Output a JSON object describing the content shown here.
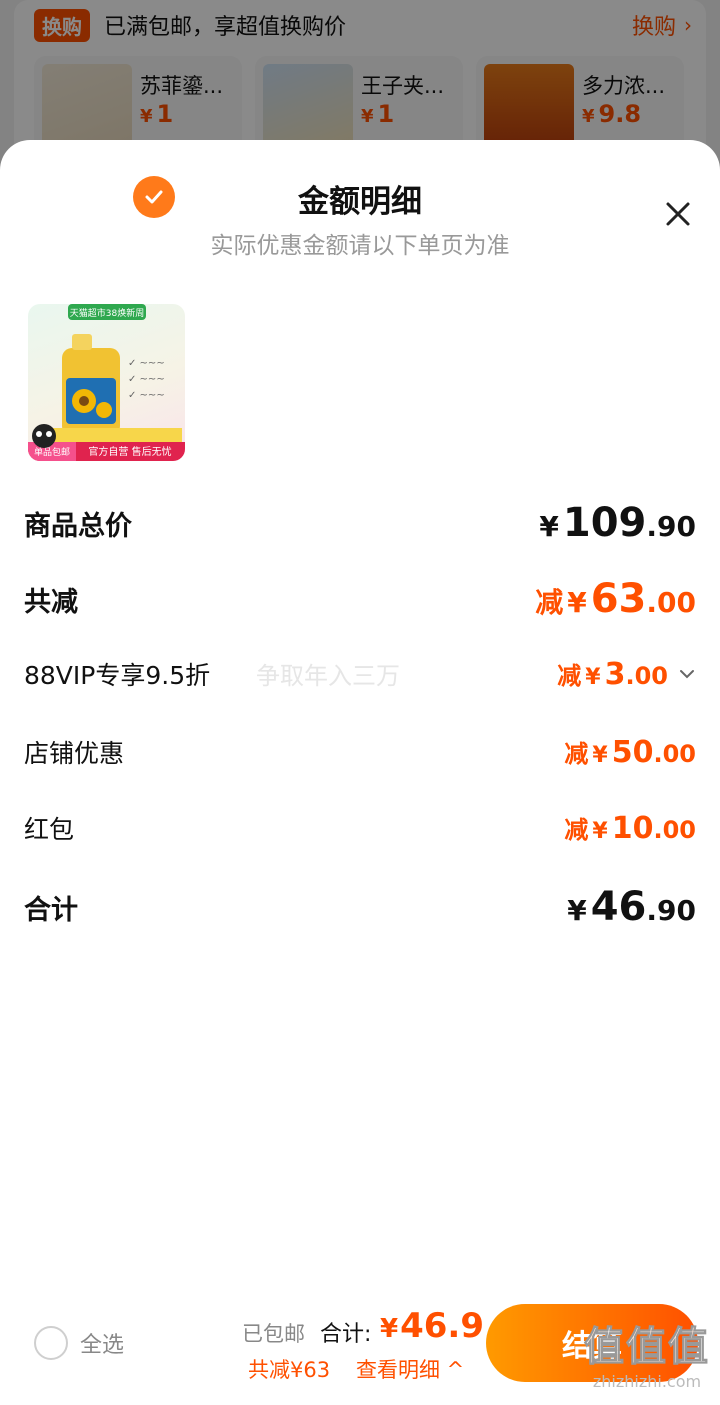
{
  "background": {
    "promo_tag": "换购",
    "promo_text": "已满包邮，享超值换购价",
    "promo_link": "换购",
    "suggestions": [
      {
        "name": "苏菲鎏...",
        "price": "1"
      },
      {
        "name": "王子夹...",
        "price": "1"
      },
      {
        "name": "多力浓...",
        "price": "9.8"
      }
    ],
    "currency": "¥"
  },
  "sheet": {
    "title": "金额明细",
    "subtitle": "实际优惠金额请以下单页为准",
    "product_badge_top": "天猫超市38焕新周",
    "product_badge_bottom": "单品包邮",
    "product_caption": "官方自营 售后无忧",
    "rows": {
      "total_price": {
        "label": "商品总价",
        "currency": "¥",
        "int": "109",
        "dec": ".90"
      },
      "total_reduced": {
        "label": "共减",
        "minus": "减",
        "currency": "¥",
        "int": "63",
        "dec": ".00"
      },
      "vip": {
        "label": "88VIP专享9.5折",
        "minus": "减",
        "currency": "¥",
        "int": "3",
        "dec": ".00"
      },
      "store": {
        "label": "店铺优惠",
        "minus": "减",
        "currency": "¥",
        "int": "50",
        "dec": ".00"
      },
      "red_packet": {
        "label": "红包",
        "minus": "减",
        "currency": "¥",
        "int": "10",
        "dec": ".00"
      },
      "sum": {
        "label": "合计",
        "currency": "¥",
        "int": "46",
        "dec": ".90"
      }
    },
    "mid_watermark": "争取年入三万"
  },
  "bottom": {
    "select_all": "全选",
    "shipping": "已包邮",
    "total_label": "合计:",
    "total_currency": "¥",
    "total_value": "46.9",
    "saved_text": "共减¥63",
    "detail_link": "查看明细",
    "checkout_label": "结算",
    "watermark_big": "值值值",
    "watermark_small": "zhizhizhi.com"
  },
  "colors": {
    "accent": "#ff5000",
    "check": "#ff7a1a"
  }
}
